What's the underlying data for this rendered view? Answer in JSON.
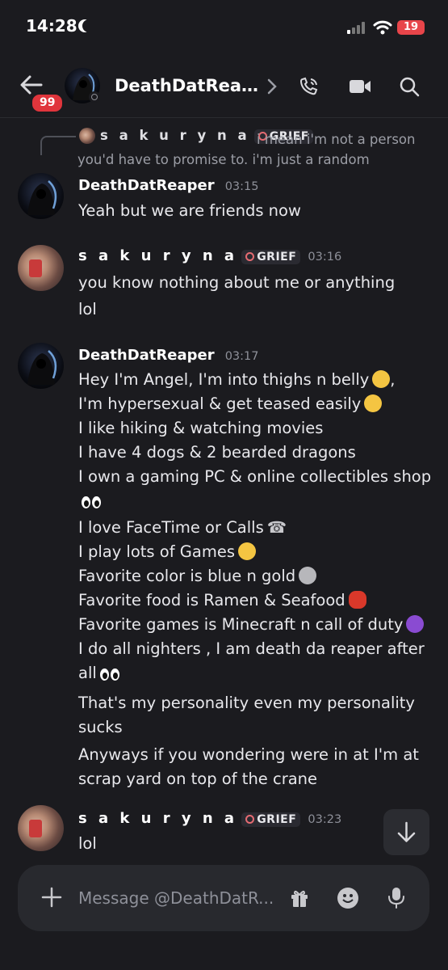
{
  "status_bar": {
    "time": "14:28",
    "battery": "19"
  },
  "header": {
    "back_badge": "99",
    "title": "DeathDatRea…"
  },
  "reply": {
    "author": "s a k u r y n a",
    "tag": "GRIEF",
    "text": "i mean i'm not a person you'd have to promise to. i'm just a random"
  },
  "messages": [
    {
      "author": "DeathDatReaper",
      "time": "03:15",
      "lines": [
        "Yeah but we are friends now"
      ]
    },
    {
      "author": "s a k u r y n a",
      "tag": "GRIEF",
      "time": "03:16",
      "lines": [
        "you know nothing about me or anything",
        "lol"
      ]
    },
    {
      "author": "DeathDatReaper",
      "time": "03:17",
      "lines": [
        "Hey I'm Angel, I'm into thighs n belly",
        "I'm hypersexual & get teased easily",
        "I like hiking & watching movies",
        "I have 4 dogs & 2 bearded dragons",
        "I own a gaming PC & online collectibles shop",
        "I love FaceTime or Calls",
        "I play lots of Games",
        "Favorite color is blue n gold",
        "Favorite food is Ramen & Seafood",
        "Favorite games is Minecraft n call of duty",
        "I do all nighters , I am death da reaper after all",
        "That's my personality even my personality sucks",
        "Anyways if you wondering were in at I'm at scrap yard on top of the crane"
      ]
    },
    {
      "author": "s a k u r y n a",
      "tag": "GRIEF",
      "time": "03:23",
      "lines": [
        "lol"
      ]
    }
  ],
  "composer": {
    "placeholder": "Message @DeathDatR..."
  },
  "icons": {
    "back": "arrow-left-icon",
    "call": "phone-call-icon",
    "video": "video-camera-icon",
    "search": "search-icon",
    "plus": "plus-icon",
    "gift": "gift-icon",
    "emoji": "emoji-icon",
    "mic": "microphone-icon",
    "scroll": "arrow-down-icon"
  },
  "colors": {
    "background": "#1b1b1f",
    "badge": "#e0353c",
    "battery": "#e8454a"
  }
}
